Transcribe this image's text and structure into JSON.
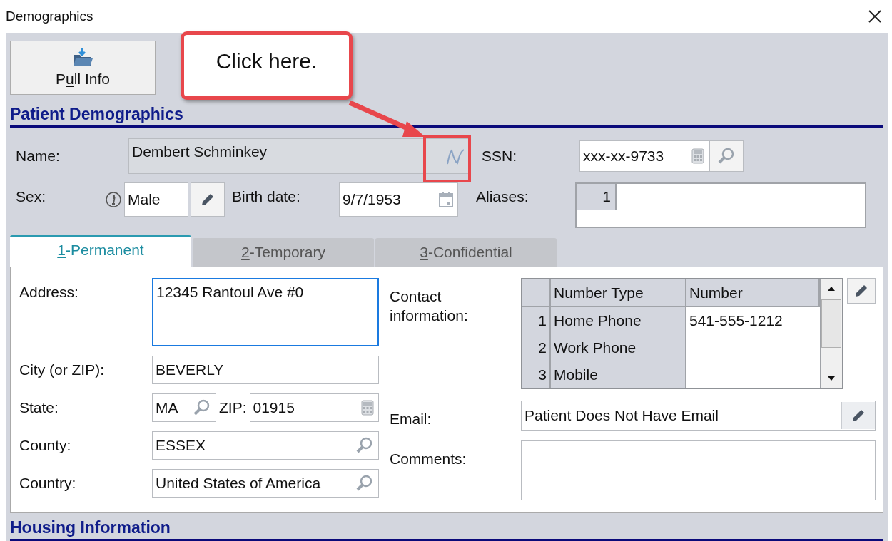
{
  "window": {
    "title": "Demographics"
  },
  "pull_button": {
    "label_start": "P",
    "access_key": "u",
    "label_end": "ll Info"
  },
  "callout": {
    "text": "Click here."
  },
  "section_title": "Patient Demographics",
  "name": {
    "label": "Name:",
    "value": "Dembert Schminkey",
    "disabled": true
  },
  "ssn": {
    "label": "SSN:",
    "value": "xxx-xx-9733"
  },
  "sex": {
    "label": "Sex:",
    "value": "Male"
  },
  "birth_date": {
    "label": "Birth date:",
    "value": "9/7/1953"
  },
  "aliases": {
    "label": "Aliases:",
    "rows": [
      {
        "index": "1"
      }
    ]
  },
  "tabs": [
    {
      "access_key": "1",
      "label_end": "-Permanent",
      "selected": true
    },
    {
      "access_key": "2",
      "label_end": "-Temporary",
      "selected": false
    },
    {
      "access_key": "3",
      "label_end": "-Confidential",
      "selected": false
    }
  ],
  "address": {
    "label": "Address:",
    "value": "12345 Rantoul Ave #0",
    "focused": true
  },
  "city": {
    "label": "City (or ZIP):",
    "value": "BEVERLY"
  },
  "state": {
    "label": "State:",
    "value": "MA"
  },
  "zip": {
    "label": "ZIP:",
    "value": "01915"
  },
  "county": {
    "label": "County:",
    "value": "ESSEX"
  },
  "country": {
    "label": "Country:",
    "value": "United States of America"
  },
  "contact": {
    "label": "Contact information:",
    "columns": [
      "Number Type",
      "Number"
    ],
    "rows": [
      {
        "index": "1",
        "type": "Home Phone",
        "number": "541-555-1212"
      },
      {
        "index": "2",
        "type": "Work Phone"
      },
      {
        "index": "3",
        "type": "Mobile"
      }
    ]
  },
  "email": {
    "label": "Email:",
    "value": "Patient Does Not Have Email"
  },
  "comments": {
    "label": "Comments:"
  },
  "housing_title": "Housing Information"
}
